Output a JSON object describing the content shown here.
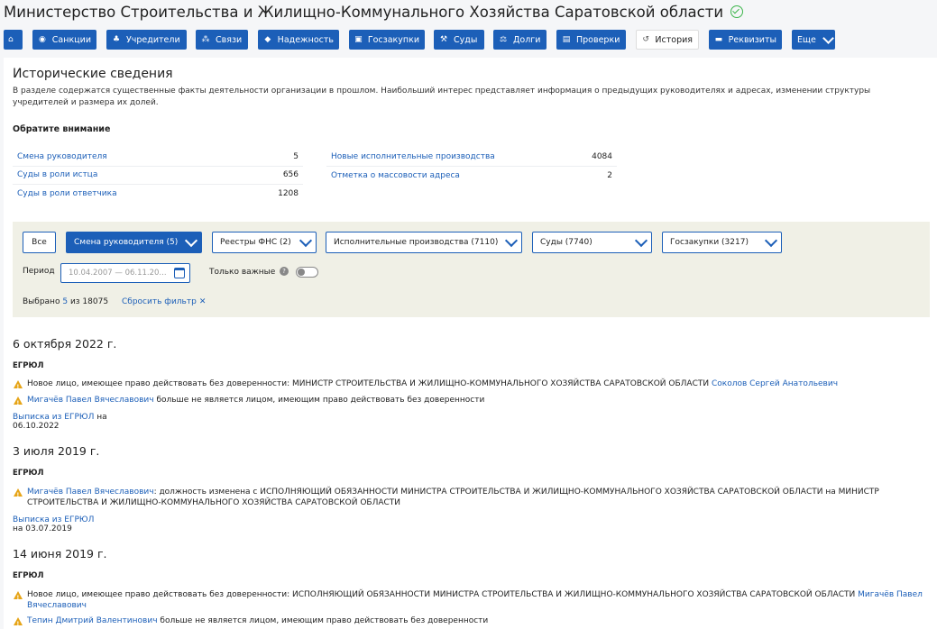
{
  "header": {
    "title": "Министерство Строительства и Жилищно-Коммунального Хозяйства Саратовской области"
  },
  "nav": {
    "items": [
      {
        "label": "",
        "icon": "home-icon"
      },
      {
        "label": "Санкции",
        "icon": "globe-icon"
      },
      {
        "label": "Учредители",
        "icon": "users-icon"
      },
      {
        "label": "Связи",
        "icon": "network-icon"
      },
      {
        "label": "Надежность",
        "icon": "shield-icon"
      },
      {
        "label": "Госзакупки",
        "icon": "contract-icon"
      },
      {
        "label": "Суды",
        "icon": "gavel-icon"
      },
      {
        "label": "Долги",
        "icon": "scales-icon"
      },
      {
        "label": "Проверки",
        "icon": "clipboard-icon"
      },
      {
        "label": "История",
        "icon": "history-icon"
      },
      {
        "label": "Реквизиты",
        "icon": "document-icon"
      },
      {
        "label": "Еще",
        "icon": "chevron-down-icon"
      }
    ]
  },
  "main": {
    "title": "Исторические сведения",
    "description": "В разделе содержатся существенные факты деятельности организации в прошлом. Наибольший интерес представляет информация о предыдущих руководителях и адресах, изменении структуры учредителей и размера их долей.",
    "notice_title": "Обратите внимание",
    "facts_left": [
      {
        "label": "Смена руководителя",
        "value": "5"
      },
      {
        "label": "Суды в роли истца",
        "value": "656"
      },
      {
        "label": "Суды в роли ответчика",
        "value": "1208"
      }
    ],
    "facts_right": [
      {
        "label": "Новые исполнительные производства",
        "value": "4084"
      },
      {
        "label": "Отметка о массовости адреса",
        "value": "2"
      }
    ]
  },
  "filter": {
    "all_label": "Все",
    "buttons": [
      {
        "label": "Смена руководителя (5)"
      },
      {
        "label": "Реестры ФНС (2)"
      },
      {
        "label": "Исполнительные производства (7110)"
      },
      {
        "label": "Суды (7740)"
      },
      {
        "label": "Госзакупки (3217)"
      }
    ],
    "period_label": "Период",
    "period_value": "10.04.2007 — 06.11.20...",
    "important_label": "Только важные",
    "help": "?",
    "selected_prefix": "Выбрано",
    "selected_count": "5",
    "selected_suffix": "из 18075",
    "reset_label": "Сбросить фильтр",
    "reset_icon": "✕"
  },
  "events": [
    {
      "date": "6 октября 2022 г.",
      "source": "ЕГРЮЛ",
      "line1_text": "Новое лицо, имеющее право действовать без доверенности: МИНИСТР СТРОИТЕЛЬСТВА И ЖИЛИЩНО-КОММУНАЛЬНОГО ХОЗЯЙСТВА САРАТОВСКОЙ ОБЛАСТИ",
      "line1_link": "Соколов Сергей Анатольевич",
      "line2_link": "Мигачёв Павел Вячеславович",
      "line2_text": "больше не является лицом, имеющим право действовать без доверенности",
      "extract_link": "Выписка из ЕГРЮЛ",
      "extract_date": "на 06.10.2022"
    },
    {
      "date": "3 июля 2019 г.",
      "source": "ЕГРЮЛ",
      "line1_link": "Мигачёв Павел Вячеславович",
      "line1_text": ": должность изменена с ИСПОЛНЯЮЩИЙ ОБЯЗАННОСТИ МИНИСТРА СТРОИТЕЛЬСТВА И ЖИЛИЩНО-КОММУНАЛЬНОГО ХОЗЯЙСТВА САРАТОВСКОЙ ОБЛАСТИ на МИНИСТР СТРОИТЕЛЬСТВА И ЖИЛИЩНО-КОММУНАЛЬНОГО ХОЗЯЙСТВА САРАТОВСКОЙ ОБЛАСТИ",
      "extract_link": "Выписка из ЕГРЮЛ",
      "extract_date": "на 03.07.2019"
    },
    {
      "date": "14 июня 2019 г.",
      "source": "ЕГРЮЛ",
      "line1_text": "Новое лицо, имеющее право действовать без доверенности: ИСПОЛНЯЮЩИЙ ОБЯЗАННОСТИ МИНИСТРА СТРОИТЕЛЬСТВА И ЖИЛИЩНО-КОММУНАЛЬНОГО ХОЗЯЙСТВА САРАТОВСКОЙ ОБЛАСТИ",
      "line1_link": "Мигачёв Павел Вячеславович",
      "line2_link": "Тепин Дмитрий Валентинович",
      "line2_text": "больше не является лицом, имеющим право действовать без доверенности"
    }
  ]
}
